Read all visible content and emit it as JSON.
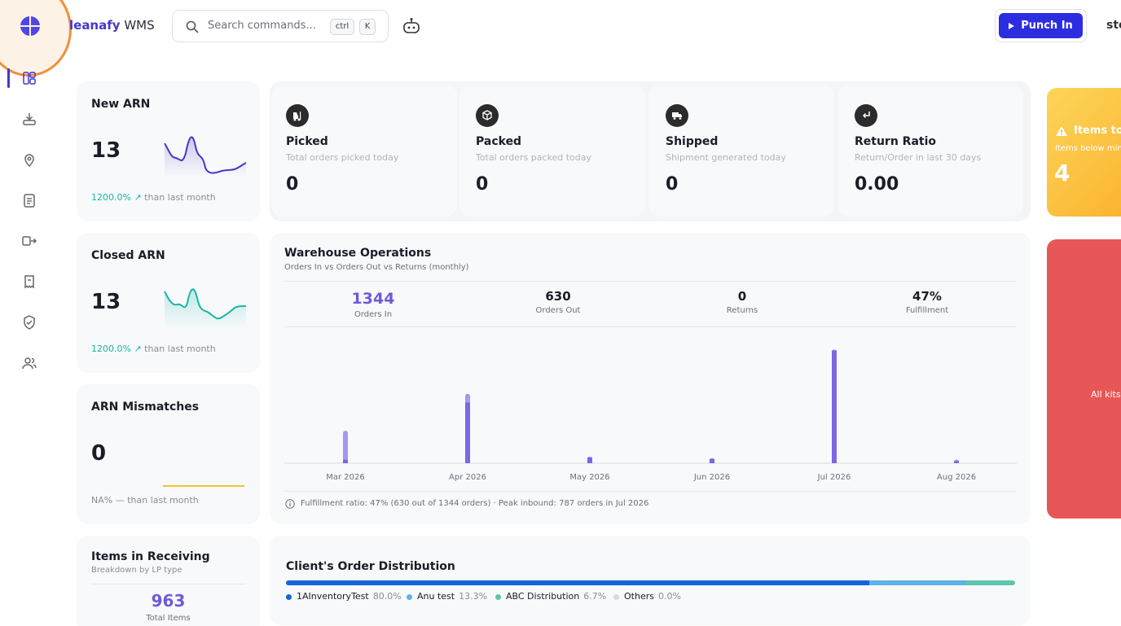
{
  "header": {
    "brand_prefix": "leanafy",
    "brand_suffix": "WMS",
    "search_placeholder": "Search commands...",
    "kbd_ctrl": "ctrl",
    "kbd_k": "K",
    "punch_label": "Punch In",
    "user_partial": "sto"
  },
  "sidebar": {
    "icons": [
      "dashboard-icon",
      "receiving-icon",
      "location-icon",
      "clipboard-icon",
      "transfer-icon",
      "document-icon",
      "shield-check-icon",
      "users-icon"
    ]
  },
  "cards": {
    "new_arn": {
      "title": "New ARN",
      "value": "13",
      "change": "1200.0%",
      "suffix": "than last month"
    },
    "closed_arn": {
      "title": "Closed ARN",
      "value": "13",
      "change": "1200.0%",
      "suffix": "than last month"
    },
    "arn_mismatches": {
      "title": "ARN Mismatches",
      "value": "0",
      "change": "NA%",
      "dash": "—",
      "suffix": "than last month"
    },
    "items_receiving": {
      "title": "Items in Receiving",
      "subtitle": "Breakdown by LP type",
      "value": "963",
      "value_label": "Total Items"
    }
  },
  "stats": [
    {
      "title": "Picked",
      "subtitle": "Total orders picked today",
      "value": "0",
      "icon": "forklift-icon"
    },
    {
      "title": "Packed",
      "subtitle": "Total orders packed today",
      "value": "0",
      "icon": "box-icon"
    },
    {
      "title": "Shipped",
      "subtitle": "Shipment generated today",
      "value": "0",
      "icon": "truck-icon"
    },
    {
      "title": "Return Ratio",
      "subtitle": "Return/Order in last 30 days",
      "value": "0.00",
      "icon": "return-icon"
    }
  ],
  "right_panel": {
    "alert_title": "Items to",
    "alert_sub": "Items below min",
    "alert_value": "4",
    "red_text": "All kits"
  },
  "warehouse": {
    "title": "Warehouse Operations",
    "subtitle": "Orders In vs Orders Out vs Returns (monthly)",
    "kpis": [
      {
        "value": "1344",
        "label": "Orders In"
      },
      {
        "value": "630",
        "label": "Orders Out"
      },
      {
        "value": "0",
        "label": "Returns"
      },
      {
        "value": "47%",
        "label": "Fulfillment"
      }
    ],
    "footnote": "Fulfillment ratio: 47% (630 out of 1344 orders) · Peak inbound: 787 orders in Jul 2026"
  },
  "chart_data": {
    "type": "bar",
    "categories": [
      "Mar 2026",
      "Apr 2026",
      "May 2026",
      "Jun 2026",
      "Jul 2026",
      "Aug 2026"
    ],
    "series": [
      {
        "name": "Orders In",
        "values": [
          225,
          480,
          45,
          35,
          787,
          25
        ]
      },
      {
        "name": "Orders Out",
        "values": [
          25,
          420,
          40,
          30,
          780,
          15
        ]
      }
    ],
    "ylim": [
      0,
      800
    ],
    "grid": false,
    "colors": {
      "orders_in": "#a897ee",
      "orders_out": "#7c66e6"
    }
  },
  "distribution": {
    "title": "Client's Order Distribution",
    "items": [
      {
        "name": "1AInventoryTest",
        "pct": "80.0%",
        "value": 80.0,
        "color": "#1565d8"
      },
      {
        "name": "Anu test",
        "pct": "13.3%",
        "value": 13.3,
        "color": "#5fb2e6"
      },
      {
        "name": "ABC Distribution",
        "pct": "6.7%",
        "value": 6.7,
        "color": "#5cc6ad"
      },
      {
        "name": "Others",
        "pct": "0.0%",
        "value": 0.0,
        "color": "#d8dadf"
      }
    ]
  }
}
